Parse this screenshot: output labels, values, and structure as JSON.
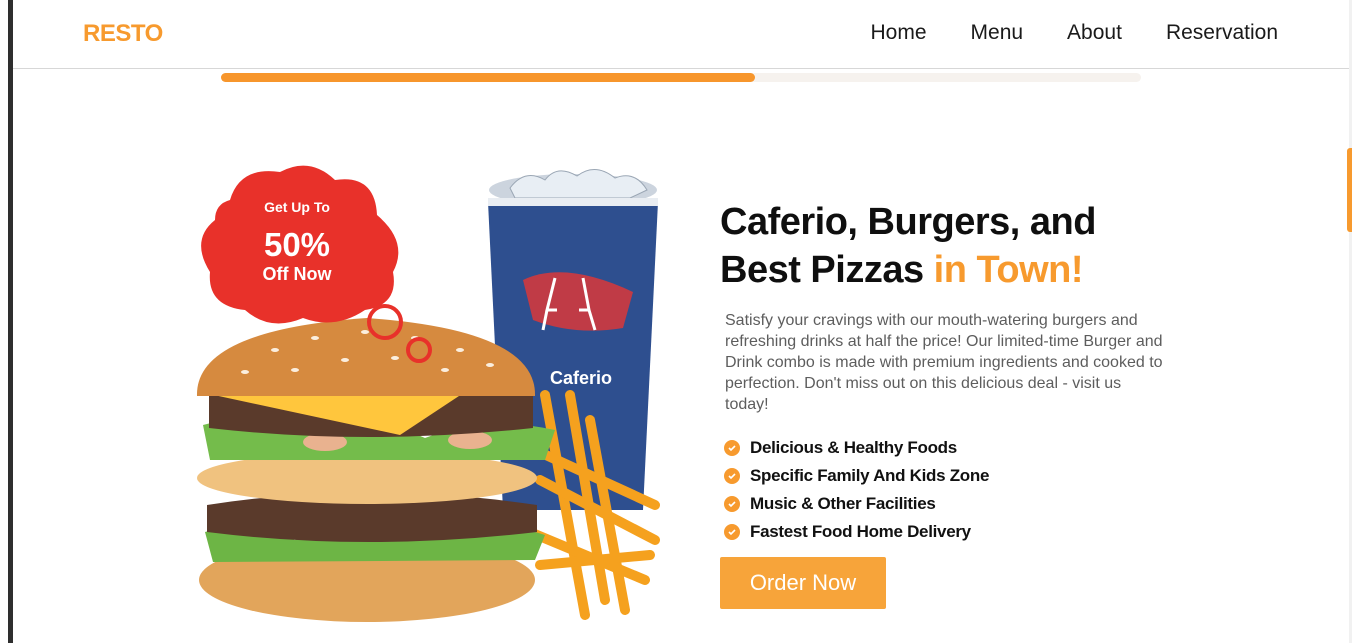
{
  "header": {
    "logo": "RESTO",
    "nav": [
      {
        "label": "Home"
      },
      {
        "label": "Menu"
      },
      {
        "label": "About"
      },
      {
        "label": "Reservation"
      }
    ]
  },
  "scroll_progress": 0.58,
  "hero": {
    "badge": {
      "line1": "Get Up To",
      "line2": "50%",
      "line3": "Off Now"
    },
    "cup_brand": "Caferio",
    "title_main_line1": "Caferio, Burgers, and",
    "title_main_line2": "Best Pizzas",
    "title_accent": "in Town!",
    "description": "Satisfy your cravings with our mouth-watering burgers and refreshing drinks at half the price! Our limited-time Burger and Drink combo is made with premium ingredients and cooked to perfection. Don't miss out on this delicious deal - visit us today!",
    "features": [
      {
        "text": "Delicious & Healthy Foods"
      },
      {
        "text": "Specific Family And Kids Zone"
      },
      {
        "text": "Music & Other Facilities"
      },
      {
        "text": "Fastest Food Home Delivery"
      }
    ],
    "cta_label": "Order Now"
  },
  "colors": {
    "accent": "#f79a2e",
    "badge_red": "#e8312a",
    "cup_blue": "#2e4f8f"
  }
}
